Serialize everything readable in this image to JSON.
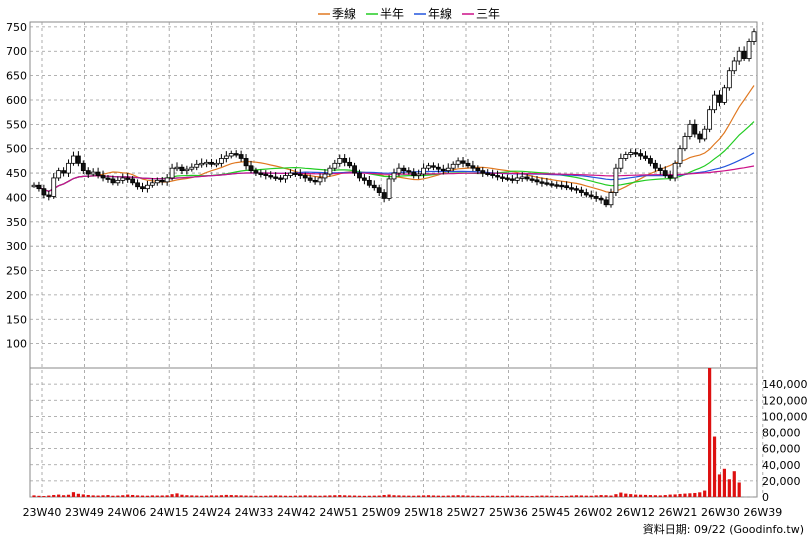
{
  "chart_data": {
    "type": "candlestick",
    "legend": [
      {
        "name": "季線",
        "color": "#e07820"
      },
      {
        "name": "半年",
        "color": "#22cc22"
      },
      {
        "name": "年線",
        "color": "#2255dd"
      },
      {
        "name": "三年",
        "color": "#cc1188"
      }
    ],
    "x_tick_labels": [
      "23W40",
      "23W49",
      "24W06",
      "24W15",
      "24W24",
      "24W33",
      "24W42",
      "24W51",
      "25W09",
      "25W18",
      "25W27",
      "25W36",
      "25W45",
      "26W02",
      "26W12",
      "26W21",
      "26W30",
      "26W39"
    ],
    "price_axis": {
      "ylim": [
        50,
        760
      ],
      "ticks": [
        100,
        150,
        200,
        250,
        300,
        350,
        400,
        450,
        500,
        550,
        600,
        650,
        700,
        750
      ]
    },
    "volume_axis": {
      "ylim": [
        0,
        160000
      ],
      "ticks": [
        "0",
        "20,000",
        "40,000",
        "60,000",
        "80,000",
        "100,000",
        "120,000",
        "140,000"
      ]
    },
    "weekly_close": [
      425,
      418,
      405,
      402,
      440,
      455,
      450,
      470,
      485,
      470,
      455,
      448,
      452,
      445,
      440,
      438,
      430,
      435,
      440,
      438,
      430,
      422,
      418,
      425,
      430,
      435,
      432,
      440,
      460,
      462,
      455,
      458,
      462,
      468,
      470,
      472,
      468,
      470,
      480,
      485,
      490,
      488,
      480,
      465,
      455,
      450,
      448,
      445,
      442,
      440,
      438,
      445,
      450,
      448,
      445,
      440,
      435,
      432,
      440,
      448,
      460,
      470,
      480,
      472,
      465,
      450,
      440,
      435,
      425,
      420,
      410,
      398,
      438,
      450,
      460,
      455,
      452,
      445,
      448,
      460,
      465,
      462,
      458,
      455,
      460,
      468,
      475,
      470,
      465,
      460,
      455,
      450,
      448,
      445,
      442,
      440,
      438,
      435,
      440,
      442,
      438,
      436,
      432,
      430,
      428,
      426,
      425,
      424,
      420,
      418,
      415,
      410,
      405,
      402,
      398,
      395,
      385,
      410,
      460,
      480,
      488,
      492,
      490,
      485,
      480,
      470,
      460,
      455,
      445,
      440,
      470,
      500,
      525,
      550,
      530,
      520,
      540,
      580,
      610,
      595,
      625,
      660,
      680,
      700,
      685,
      720,
      740
    ],
    "weekly_volume": [
      2000,
      1500,
      1200,
      1800,
      2500,
      3000,
      2200,
      2800,
      6000,
      4000,
      3200,
      2500,
      2000,
      1800,
      2100,
      2400,
      1600,
      1800,
      2200,
      3000,
      2500,
      2000,
      1800,
      1600,
      2000,
      1800,
      1900,
      2100,
      3500,
      4500,
      2800,
      2200,
      2000,
      1800,
      1600,
      1800,
      2000,
      1900,
      2200,
      2600,
      2400,
      2200,
      2000,
      1800,
      1700,
      1600,
      1500,
      1600,
      1800,
      2000,
      1800,
      1600,
      1500,
      1700,
      1800,
      2000,
      1900,
      1700,
      1600,
      1800,
      2000,
      2200,
      2400,
      2100,
      1900,
      1800,
      1600,
      1500,
      1600,
      1700,
      1800,
      2500,
      3000,
      2200,
      2000,
      1800,
      1700,
      1600,
      1800,
      2000,
      2200,
      1900,
      1700,
      1600,
      1800,
      2000,
      2200,
      2000,
      1800,
      1600,
      1500,
      1400,
      1600,
      1700,
      1500,
      1400,
      1600,
      1800,
      1700,
      1500,
      1400,
      1300,
      1600,
      1800,
      1700,
      1500,
      1400,
      1300,
      1500,
      1800,
      2100,
      1900,
      1700,
      1600,
      2000,
      2400,
      2200,
      1800,
      3500,
      5500,
      4200,
      3600,
      3000,
      2800,
      2600,
      2400,
      2200,
      2000,
      2400,
      3000,
      3200,
      3800,
      4200,
      4600,
      5000,
      5800,
      8000,
      160000,
      75000,
      28000,
      35000,
      22000,
      32000,
      18000
    ]
  },
  "footer": {
    "credit": "資料日期: 09/22  (Goodinfo.tw)"
  }
}
